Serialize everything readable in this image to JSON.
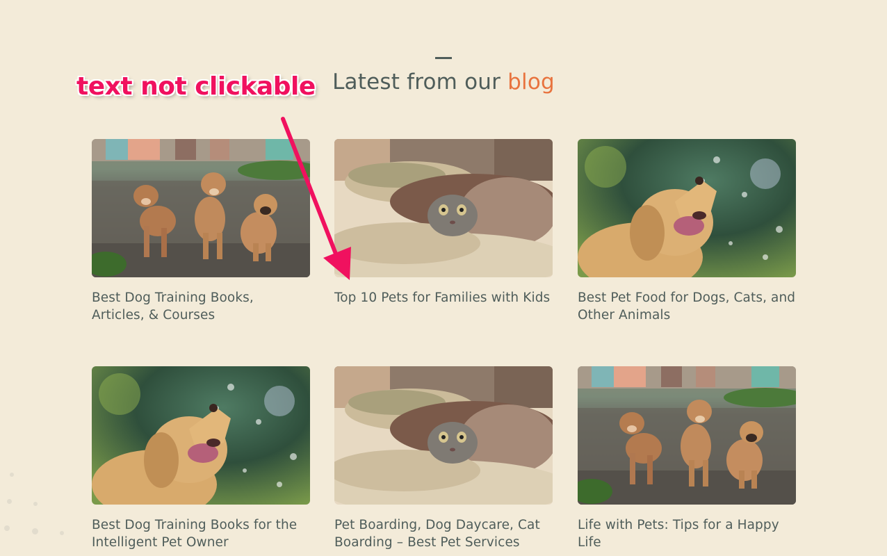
{
  "section": {
    "heading_prefix": "Latest from our ",
    "heading_accent": "blog"
  },
  "annotation": {
    "text": "text not clickable",
    "color": "#f0115f"
  },
  "colors": {
    "background": "#f3ebd9",
    "heading": "#4f5d5a",
    "accent": "#e8733e"
  },
  "posts": [
    {
      "title": "Best Dog Training Books, Articles, & Courses",
      "image": "three-puppies-photo"
    },
    {
      "title": "Top 10 Pets for Families with Kids",
      "image": "cat-under-blanket-photo"
    },
    {
      "title": "Best Pet Food for Dogs, Cats, and Other Animals",
      "image": "golden-retriever-photo"
    },
    {
      "title": "Best Dog Training Books for the Intelligent Pet Owner",
      "image": "golden-retriever-photo"
    },
    {
      "title": "Pet Boarding, Dog Daycare, Cat Boarding – Best Pet Services",
      "image": "cat-under-blanket-photo"
    },
    {
      "title": "Life with Pets: Tips for a Happy Life",
      "image": "three-puppies-photo"
    }
  ]
}
